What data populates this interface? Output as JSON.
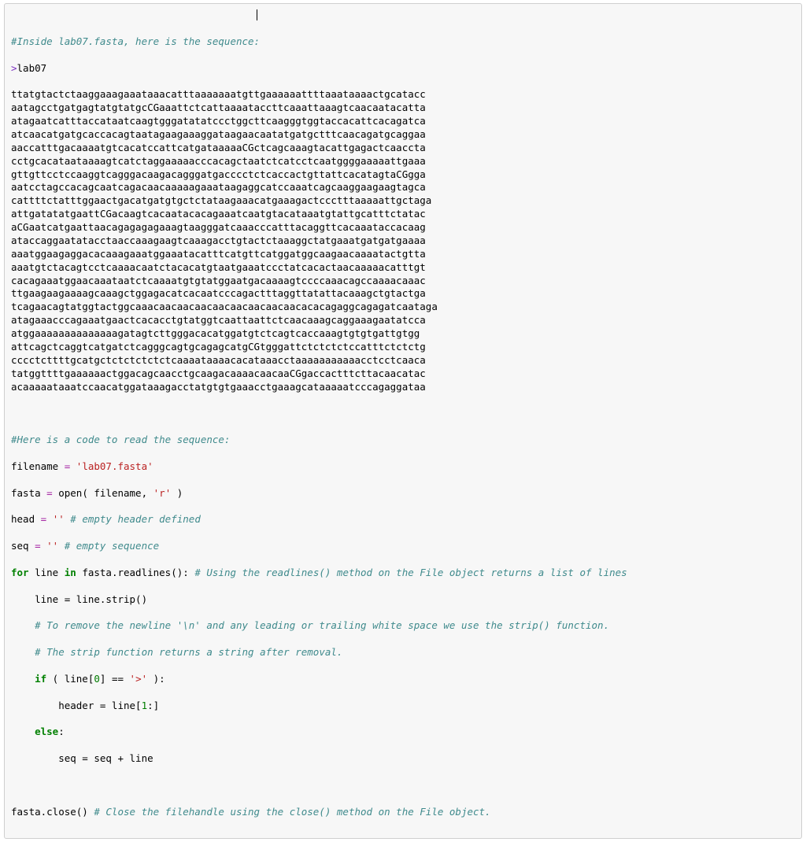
{
  "comment_top": "#Inside lab07.fasta, here is the sequence:",
  "fasta_header_gt": ">",
  "fasta_header_name": "lab07",
  "sequence_lines": [
    "ttatgtactctaaggaaagaaataaacatttaaaaaaatgttgaaaaaattttaaataaaactgcatacc",
    "aatagcctgatgagtatgtatgcCGaaattctcattaaaataccttcaaattaaagtcaacaatacatta",
    "atagaatcatttaccataatcaagtgggatatatccctggcttcaagggtggtaccacattcacagatca",
    "atcaacatgatgcaccacagtaatagaagaaaggataagaacaatatgatgctttcaacagatgcaggaa",
    "aaccatttgacaaaatgtcacatccattcatgataaaaaCGctcagcaaagtacattgagactcaaccta",
    "cctgcacataataaaagtcatctaggaaaaacccacagctaatctcatcctcaatggggaaaaattgaaa",
    "gttgttcctccaaggtcagggacaagacagggatgacccctctcaccactgttattcacatagtaCGgga",
    "aatcctagccacagcaatcagacaacaaaaagaaataagaggcatccaaatcagcaaggaagaagtagca",
    "cattttctatttggaactgacatgatgtgctctataagaaacatgaaagactccctttaaaaattgctaga",
    "attgatatatgaattCGacaagtcacaatacacagaaatcaatgtacataaatgtattgcatttctatac",
    "aCGaatcatgaattaacagagagagaaagtaagggatcaaacccatttacaggttcacaaataccacaag",
    "ataccaggaatatacctaaccaaagaagtcaaagacctgtactctaaaggctatgaaatgatgatgaaaa",
    "aaatggaagaggacacaaagaaatggaaatacatttcatgttcatggatggcaagaacaaaatactgtta",
    "aaatgtctacagtcctcaaaacaatctacacatgtaatgaaatccctatcacactaacaaaaacatttgt",
    "cacagaaatggaacaaataatctcaaaatgtgtatggaatgacaaaagtccccaaacagccaaaacaaac",
    "ttgaagaagaaaagcaaagctggagacatcacaatcccagactttaggttatattacaaagctgtactga",
    "tcagaacagtatggtactggcaaacaacaacaacaacaacaacaacaacacacagaggcagagatcaataga",
    "atagaaacccagaaatgaactcacacctgtatggtcaattaattctcaacaaagcaggaaagaatatcca",
    "atggaaaaaaaaaaaaaagatagtcttgggacacatggatgtctcagtcaccaaagtgtgtgattgtgg",
    "attcagctcaggtcatgatctcagggcagtgcagagcatgCGtgggattctctctctccatttctctctg",
    "cccctcttttgcatgctctctctctctcaaaataaaacacataaacctaaaaaaaaaaacctcctcaaca",
    "tatggttttgaaaaaactggacagcaacctgcaagacaaaacaacaaCGgaccactttcttacaacatac",
    "acaaaaataaatccaacatggataaagacctatgtgtgaaacctgaaagcataaaaatcccagaggataa"
  ],
  "comment_read": "#Here is a code to read the sequence:",
  "code": {
    "filename_var": "filename",
    "assign": " = ",
    "filename_str": "'lab07.fasta'",
    "fasta_var": "fasta",
    "open_call_pre": "open( filename, ",
    "open_mode": "'r'",
    "open_call_post": " )",
    "head_var": "head",
    "empty1": "''",
    "head_comment": " # empty header defined",
    "seq_var": "seq",
    "empty2": "''",
    "seq_comment": " # empty sequence",
    "for_kw": "for",
    "line_var": " line ",
    "in_kw": "in",
    "readlines": " fasta.readlines(): ",
    "readlines_comment": "# Using the readlines() method on the File object returns a list of lines",
    "strip_line": "    line = line.strip()",
    "strip_c1": "    # To remove the newline '\\n' and any leading or trailing white space we use the strip() function.",
    "strip_c2": "    # The strip function returns a string after removal.",
    "if_kw": "    if",
    "if_cond_pre": " ( line[",
    "zero": "0",
    "if_cond_mid": "] == ",
    "gt_str": "'>'",
    "if_cond_post": " ):",
    "header_line_pre": "        header = line[",
    "one": "1",
    "header_line_post": ":]",
    "else_kw": "    else",
    "else_colon": ":",
    "concat_line": "        seq = seq + line",
    "close_line": "fasta.close() ",
    "close_comment": "# Close the filehandle using the close() method on the File object."
  }
}
